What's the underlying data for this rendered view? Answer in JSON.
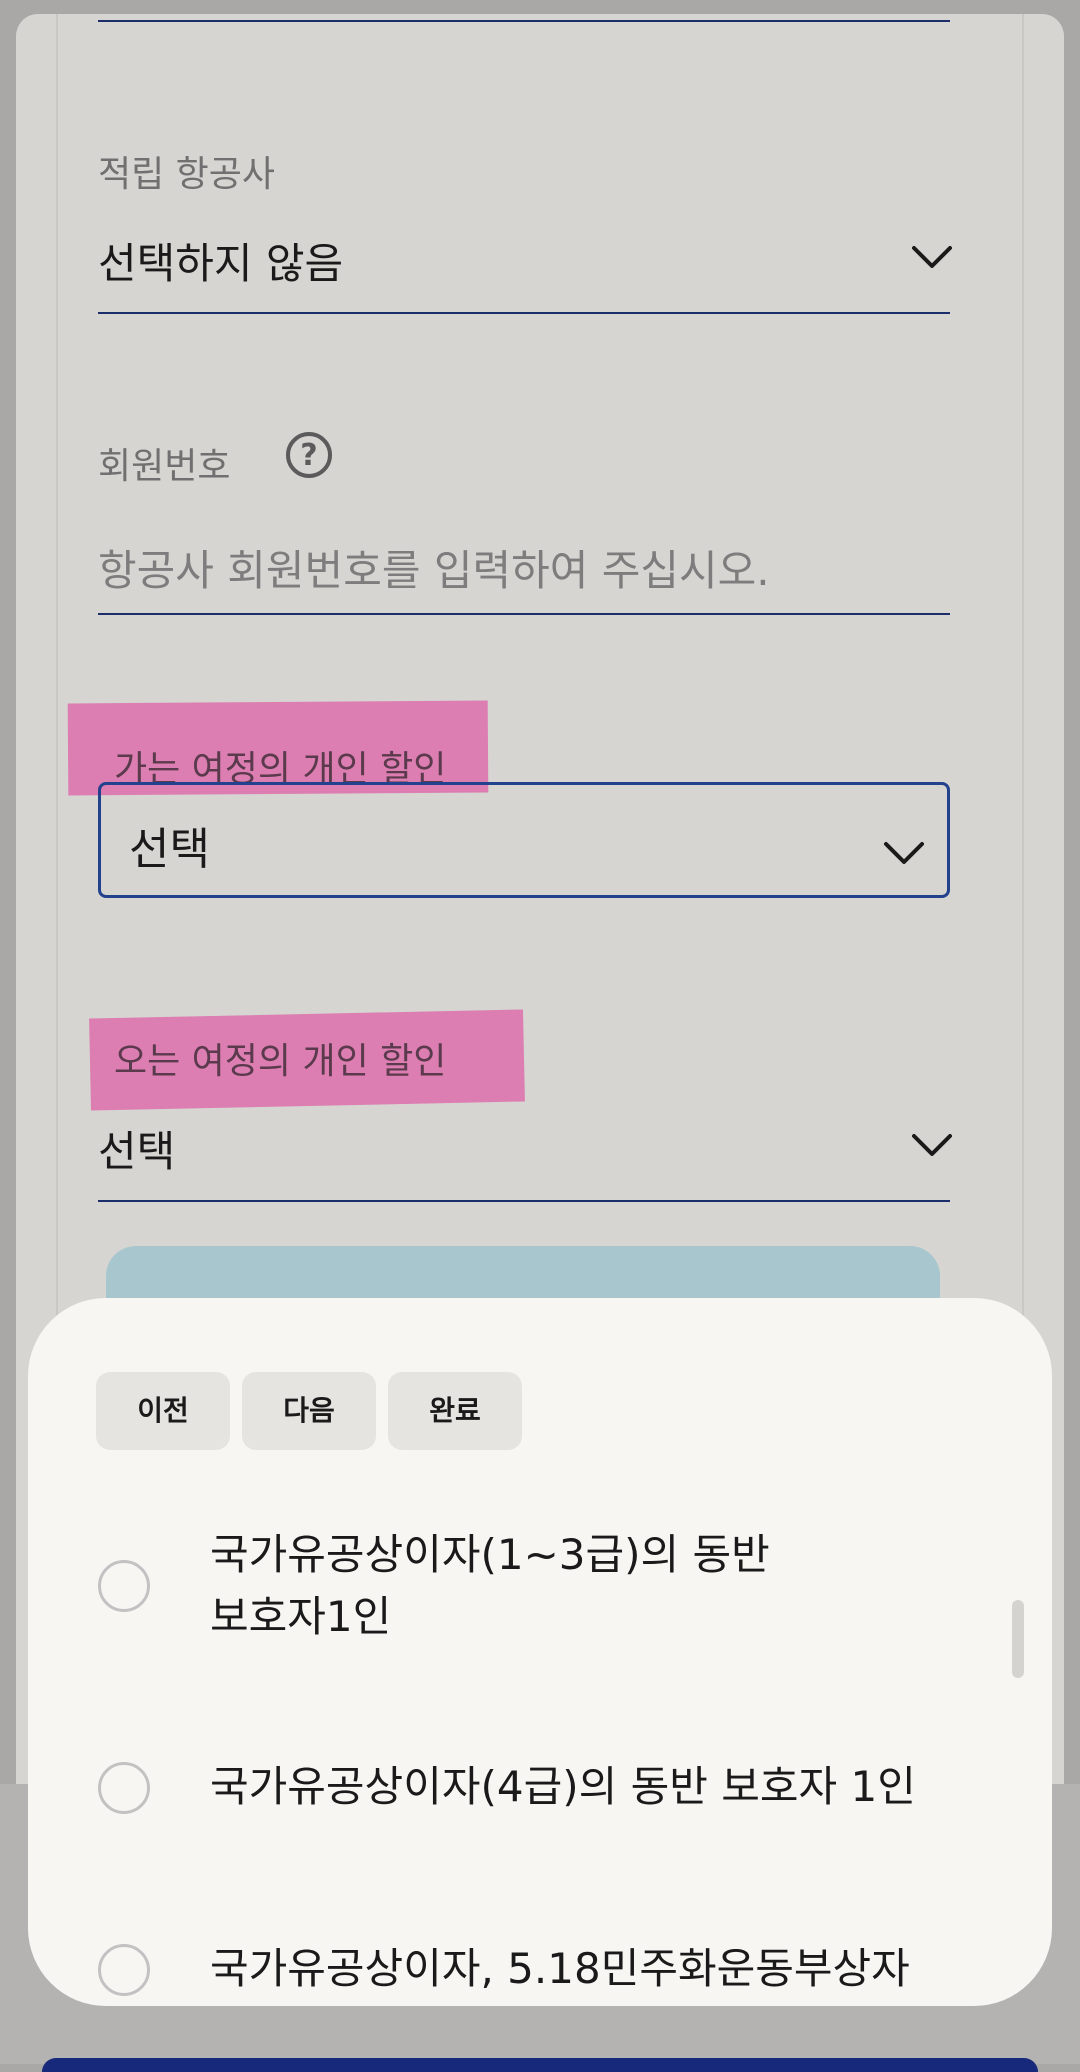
{
  "form": {
    "airline_label": "적립 항공사",
    "airline_value": "선택하지 않음",
    "member_label": "회원번호",
    "member_placeholder": "항공사 회원번호를 입력하여 주십시오.",
    "outbound_label": "가는 여정의 개인 할인",
    "outbound_value": "선택",
    "return_label": "오는 여정의 개인 할인",
    "return_value": "선택"
  },
  "sheet": {
    "toolbar": {
      "prev": "이전",
      "next": "다음",
      "done": "완료"
    },
    "options": [
      {
        "line1": "국가유공상이자(1~3급)의 동반",
        "line2": "보호자1인"
      },
      {
        "line1": "국가유공상이자(4급)의 동반 보호자 1인"
      },
      {
        "line1": "국가유공상이자, 5.18민주화운동부상자"
      }
    ]
  },
  "colors": {
    "highlight": "#de499d",
    "underline": "#1b2d6b",
    "focus_border": "#22428d",
    "button_disabled": "#a7c6ce"
  }
}
